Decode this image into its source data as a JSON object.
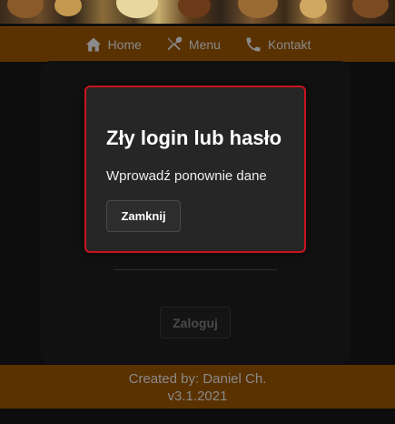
{
  "nav": {
    "items": [
      {
        "label": "Home",
        "icon": "home-icon"
      },
      {
        "label": "Menu",
        "icon": "fork-knife-icon"
      },
      {
        "label": "Kontakt",
        "icon": "phone-icon"
      }
    ]
  },
  "login": {
    "submit_label": "Zaloguj"
  },
  "modal": {
    "title": "Zły login lub hasło",
    "message": "Wprowadź ponownie dane",
    "close_label": "Zamknij"
  },
  "footer": {
    "line1": "Created by: Daniel Ch.",
    "line2": "v3.1.2021"
  },
  "colors": {
    "nav_background": "#5a3100",
    "modal_border": "#c8141c",
    "page_background": "#0d0d0d"
  }
}
